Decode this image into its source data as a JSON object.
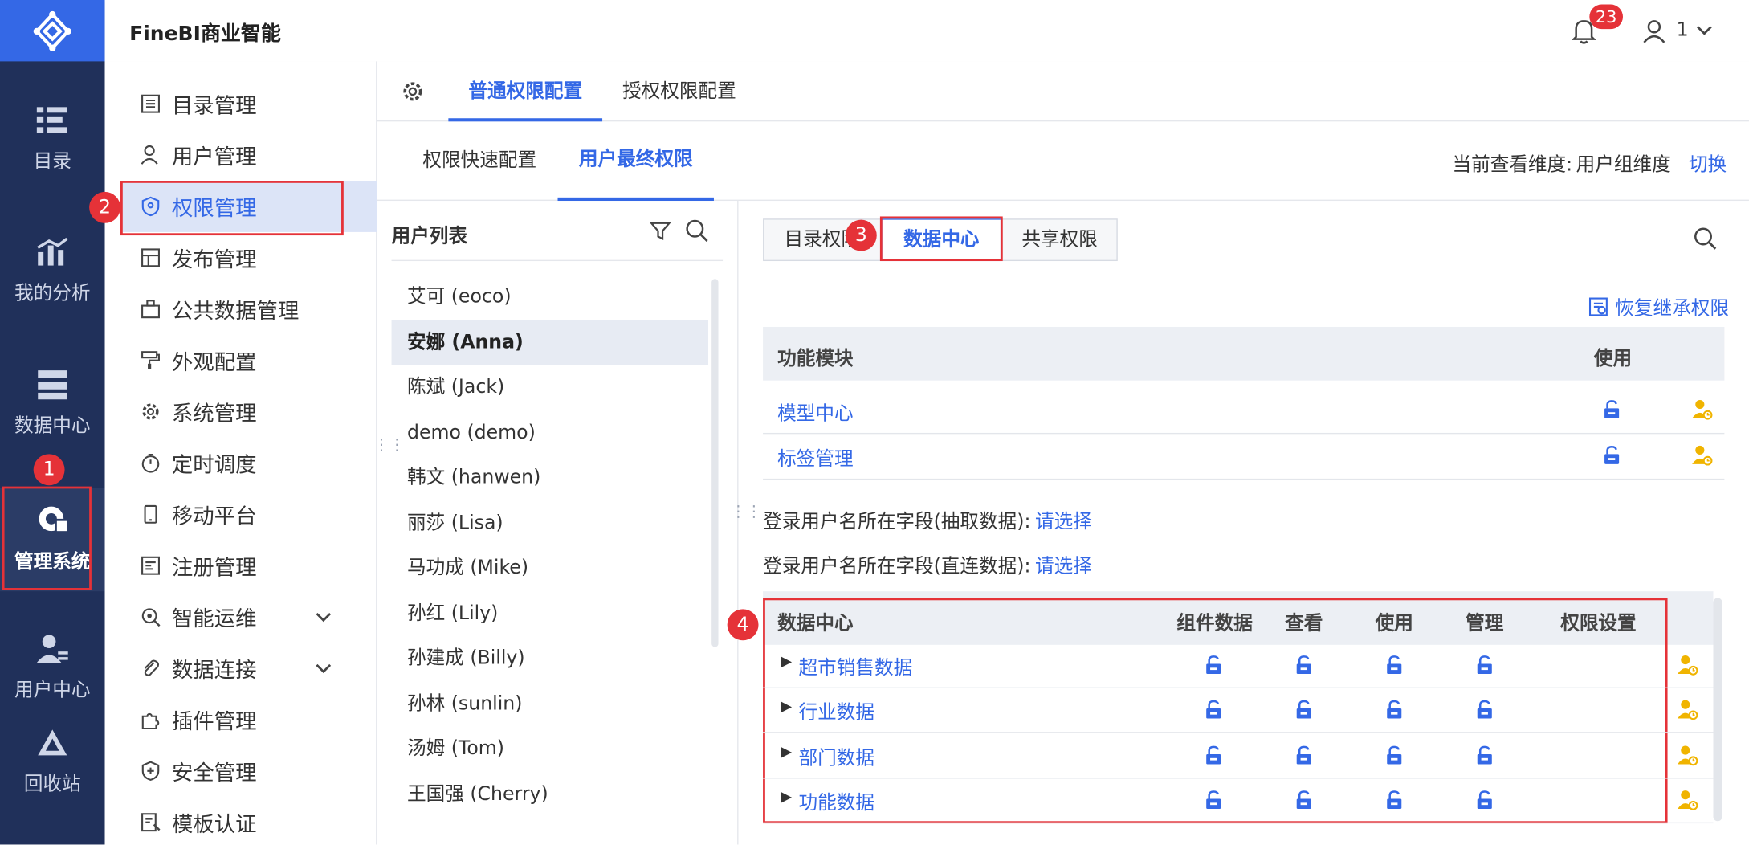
{
  "app": {
    "title": "FineBI商业智能",
    "notifications": "23",
    "user": "1"
  },
  "rail": [
    {
      "label": "目录",
      "icon": "catalog-icon"
    },
    {
      "label": "我的分析",
      "icon": "analysis-icon"
    },
    {
      "label": "数据中心",
      "icon": "data-center-icon"
    },
    {
      "label": "管理系统",
      "icon": "management-icon"
    },
    {
      "label": "用户中心",
      "icon": "user-center-icon"
    },
    {
      "label": "回收站",
      "icon": "recycle-icon"
    }
  ],
  "menu": [
    "目录管理",
    "用户管理",
    "权限管理",
    "发布管理",
    "公共数据管理",
    "外观配置",
    "系统管理",
    "定时调度",
    "移动平台",
    "注册管理",
    "智能运维",
    "数据连接",
    "插件管理",
    "安全管理",
    "模板认证"
  ],
  "tabs_top": [
    "普通权限配置",
    "授权权限配置"
  ],
  "tabs_sub": [
    "权限快速配置",
    "用户最终权限"
  ],
  "view": {
    "label": "当前查看维度:",
    "value": "用户组维度",
    "switch": "切换"
  },
  "userlist": {
    "title": "用户列表",
    "users": [
      "艾可 (eoco)",
      "安娜 (Anna)",
      "陈斌 (Jack)",
      "demo (demo)",
      "韩文 (hanwen)",
      "丽莎 (Lisa)",
      "马功成 (Mike)",
      "孙红 (Lily)",
      "孙建成 (Billy)",
      "孙林 (sunlin)",
      "汤姆 (Tom)",
      "王国强 (Cherry)"
    ]
  },
  "segments": [
    "目录权限",
    "数据中心",
    "共享权限"
  ],
  "restore": "恢复继承权限",
  "func_table": {
    "headers": [
      "功能模块",
      "使用"
    ],
    "rows": [
      "模型中心",
      "标签管理"
    ]
  },
  "fields": [
    {
      "label": "登录用户名所在字段(抽取数据):",
      "value": "请选择"
    },
    {
      "label": "登录用户名所在字段(直连数据):",
      "value": "请选择"
    }
  ],
  "data_table": {
    "headers": [
      "数据中心",
      "组件数据",
      "查看",
      "使用",
      "管理",
      "权限设置"
    ],
    "rows": [
      "超市销售数据",
      "行业数据",
      "部门数据",
      "功能数据"
    ]
  },
  "callouts": [
    "1",
    "2",
    "3",
    "4"
  ],
  "colors": {
    "accent": "#3468e6",
    "rail": "#20305a",
    "callout": "#e53238",
    "person_icon": "#f0b400"
  }
}
